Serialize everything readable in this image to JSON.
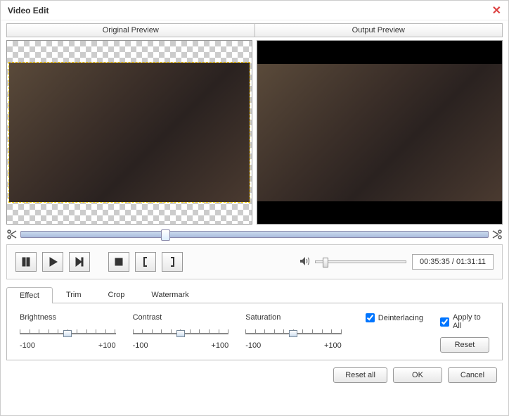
{
  "window": {
    "title": "Video Edit"
  },
  "headers": {
    "left": "Original Preview",
    "right": "Output Preview"
  },
  "controls": {
    "time": "00:35:35 / 01:31:11"
  },
  "tabs": {
    "effect": "Effect",
    "trim": "Trim",
    "crop": "Crop",
    "watermark": "Watermark"
  },
  "adjust": {
    "brightness": {
      "label": "Brightness",
      "min": "-100",
      "max": "+100"
    },
    "contrast": {
      "label": "Contrast",
      "min": "-100",
      "max": "+100"
    },
    "saturation": {
      "label": "Saturation",
      "min": "-100",
      "max": "+100"
    }
  },
  "checks": {
    "deinterlacing": "Deinterlacing",
    "applyAll": "Apply to All"
  },
  "buttons": {
    "reset": "Reset",
    "resetAll": "Reset all",
    "ok": "OK",
    "cancel": "Cancel"
  }
}
